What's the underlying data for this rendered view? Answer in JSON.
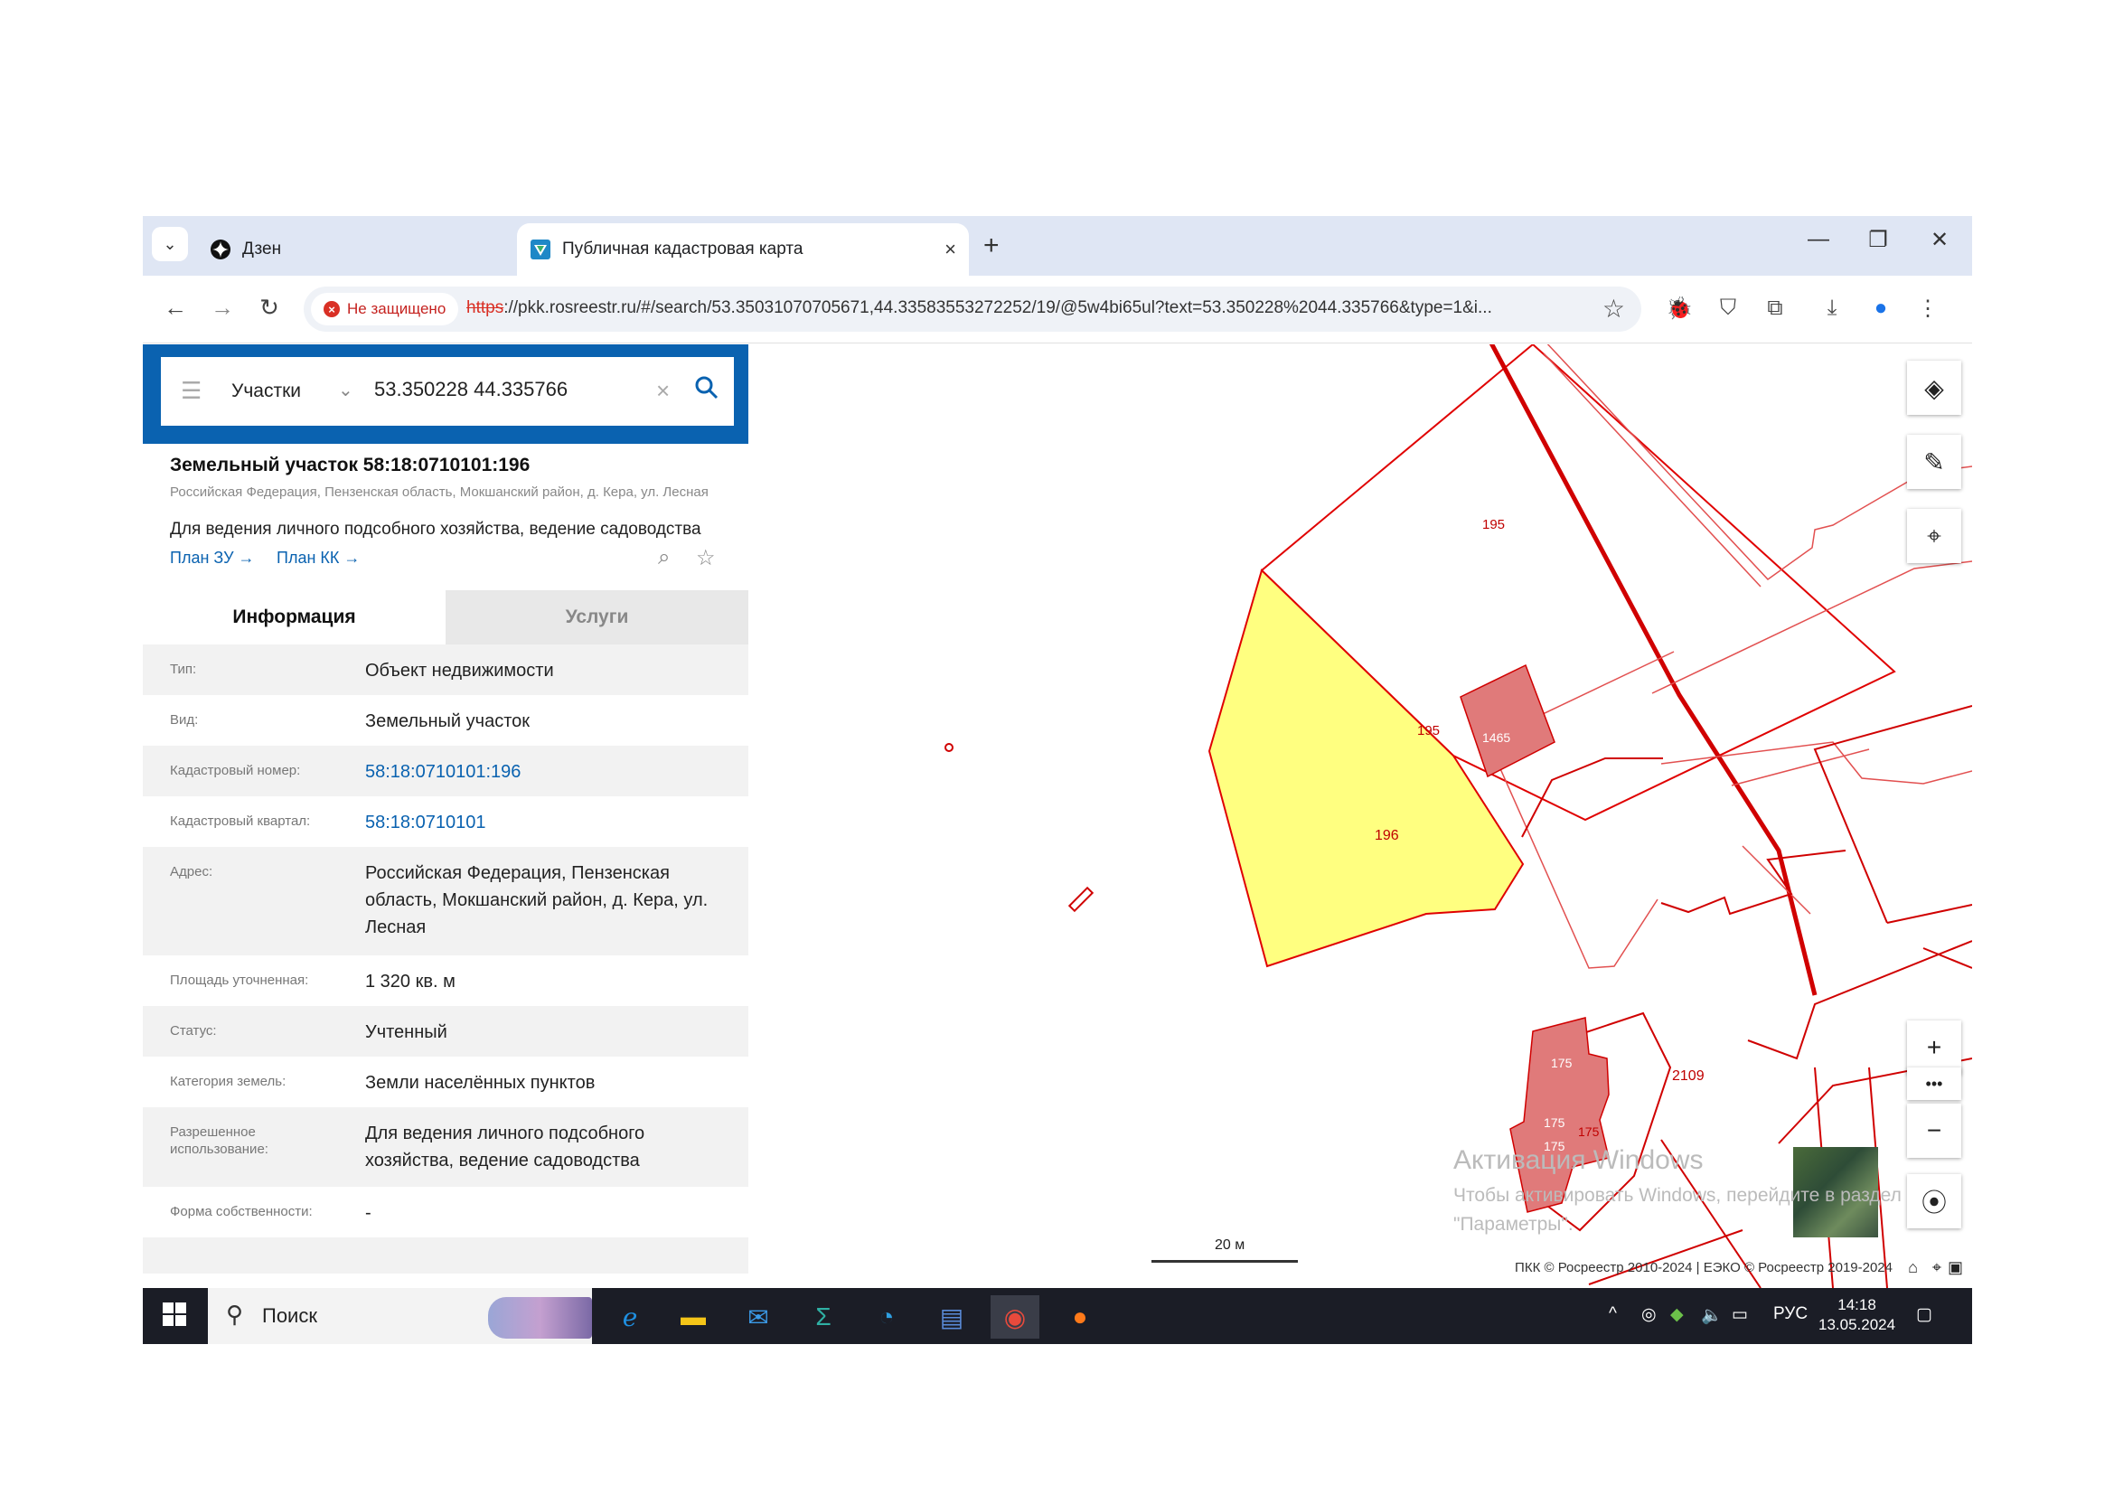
{
  "browser": {
    "tabs": [
      {
        "label": "Дзен",
        "icon": "dzen-icon"
      },
      {
        "label": "Публичная кадастровая карта",
        "icon": "rosreestr-icon"
      }
    ],
    "security_label": "Не защищено",
    "url_scheme": "https",
    "url_rest": "://pkk.rosreestr.ru/#/search/53.35031070705671,44.33583553272252/19/@5w4bi65ul?text=53.350228%2044.335766&type=1&i..."
  },
  "search": {
    "type_label": "Участки",
    "query": "53.350228 44.335766"
  },
  "parcel": {
    "title": "Земельный участок 58:18:0710101:196",
    "address_short": "Российская Федерация, Пензенская область, Мокшанский район, д. Кера, ул. Лесная",
    "use": "Для ведения личного подсобного хозяйства, ведение садоводства",
    "plan_zu": "План ЗУ →",
    "plan_kk": "План КК →"
  },
  "panel_tabs": {
    "info": "Информация",
    "services": "Услуги"
  },
  "attributes": [
    {
      "label": "Тип:",
      "value": "Объект недвижимости",
      "link": false
    },
    {
      "label": "Вид:",
      "value": "Земельный участок",
      "link": false
    },
    {
      "label": "Кадастровый номер:",
      "value": "58:18:0710101:196",
      "link": true
    },
    {
      "label": "Кадастровый квартал:",
      "value": "58:18:0710101",
      "link": true
    },
    {
      "label": "Адрес:",
      "value": "Российская Федерация, Пензенская область, Мокшанский район, д. Кера, ул. Лесная",
      "link": false
    },
    {
      "label": "Площадь уточненная:",
      "value": "1 320 кв. м",
      "link": false
    },
    {
      "label": "Статус:",
      "value": "Учтенный",
      "link": false
    },
    {
      "label": "Категория земель:",
      "value": "Земли населённых пунктов",
      "link": false
    },
    {
      "label": "Разрешенное использование:",
      "value": "Для ведения личного подсобного хозяйства, ведение садоводства",
      "link": false
    },
    {
      "label": "Форма собственности:",
      "value": "-",
      "link": false
    },
    {
      "label": "",
      "value": "",
      "link": false
    }
  ],
  "map": {
    "labels": {
      "p196": "196",
      "p195a": "195",
      "p195b": "195",
      "p1465": "1465",
      "p175a": "175",
      "p175b": "175",
      "p175c": "175",
      "p175d": "175",
      "p2109": "2109"
    },
    "scale": "20 м",
    "attribution": "ПКК © Росреестр 2010-2024 | ЕЭКО © Росреестр 2019-2024",
    "watermark_title": "Активация Windows",
    "watermark_text": "Чтобы активировать Windows, перейдите в раздел \"Параметры\".",
    "colors": {
      "selected_fill": "#ffff80",
      "boundary": "#e00000",
      "building": "#e07a7a"
    }
  },
  "taskbar": {
    "search_placeholder": "Поиск",
    "lang": "РУС",
    "time": "14:18",
    "date": "13.05.2024"
  }
}
